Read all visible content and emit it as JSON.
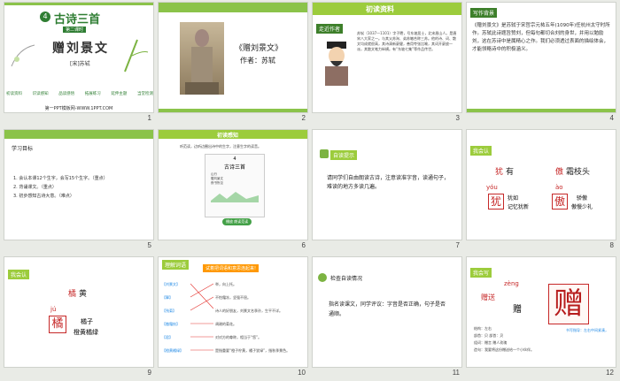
{
  "slides": [
    {
      "num": "1",
      "badge": "4",
      "title": "古诗三首",
      "subtitle": "第二课时",
      "poem_title": "赠刘景文",
      "author": "[宋]苏轼",
      "menu": [
        "初读资料",
        "识读感知",
        "品读感悟",
        "拓展练习",
        "延伸主题",
        "当堂检测"
      ],
      "footer": "第一PPT模板网-WWW.1PPT.COM"
    },
    {
      "num": "2",
      "title": "《赠刘景文》",
      "author": "作者：苏轼"
    },
    {
      "num": "3",
      "tag": "走近作者",
      "header": "初读资料",
      "bio": "苏轼（1037—1101）字子瞻，号东坡居士，北宋眉山人。是唐宋八大家之一。与其父苏洵、弟苏辙合称三苏。他的诗、词、散文均成就很高，其诗清新豪健，善用夸张比喻，其词开豪放一派，其散文笔力纵横。有“东坡七集”等作品传世。"
    },
    {
      "num": "4",
      "tag": "写作背景",
      "text": "《赠刘景文》是苏轼于宋哲宗元祐五年(1090年)任杭州太守时所作。苏轼此诗题旨赞刘，但每句都切合刘的身世，并用以勉励刘，这在苏诗中是属精心之作。我们必须透过表面的描绘体会，才能领略诗中的积极涵义。"
    },
    {
      "num": "5",
      "header": "学习目标",
      "goals": [
        "1. 会认本课12个生字，会写15个生字。（重点）",
        "2. 背诵课文。（重点）",
        "3. 初步感知古诗大意。（难点）"
      ]
    },
    {
      "num": "6",
      "header": "初读感知",
      "instruction": "听范读，边听边圈出诗中的生字，注意生字的读音。",
      "book_num": "4",
      "book_title": "古诗三首",
      "book_lines": [
        "山行",
        "赠刘景文",
        "夜书所见"
      ],
      "button": "播放 朗读范读"
    },
    {
      "num": "7",
      "tag": "自读提示",
      "text": "请同学们自由朗读古诗，注意读准字音，读通句子，难读的地方多读几遍。"
    },
    {
      "num": "8",
      "tag": "我会认",
      "chars": [
        {
          "char": "犹",
          "word": "有",
          "pinyin": "yóu",
          "words": [
            "犹如",
            "记忆犹新"
          ]
        },
        {
          "char": "傲",
          "word": "霜枝头",
          "pinyin": "ào",
          "words": [
            "骄傲",
            "傲慢少礼"
          ]
        }
      ]
    },
    {
      "num": "9",
      "tag": "我会认",
      "char": "橘",
      "word": "黄",
      "pinyin": "jú",
      "words": [
        "橘子",
        "橙黄橘绿"
      ]
    },
    {
      "num": "10",
      "header": "理解词语",
      "sub": "试着把词语和意思连起来!",
      "terms": [
        "【刘景文】",
        "【擎】",
        "【残菊】",
        "【傲霜枝】",
        "【君】",
        "【橙黄橘绿】"
      ],
      "meanings": [
        "举，向上托。",
        "不怕霜冻，坚强不屈。",
        "诗人的好朋友，刘景文名季孙，生平不详。",
        "凋谢的菊花。",
        "对对方的尊称，相当于“您”。",
        "是指重要“橙子柠黄，橘子犹绿”，指秋季景色。"
      ]
    },
    {
      "num": "11",
      "tag": "检查自读情况",
      "text": "指名读课文，同学评议：字音是否正确，句子是否通顺。"
    },
    {
      "num": "12",
      "tag": "我会写",
      "char": "赠",
      "pinyin": "zèng",
      "words": [
        "赠送",
        "赠"
      ],
      "notes": [
        "结构：左右",
        "部首：贝 部首：贝",
        "组词：赠言 赠人玫瑰",
        "造句：我要将这份赠送给一个小伙伴。"
      ],
      "tip": "书写指导：左右中间紧凑，"
    }
  ],
  "colors": {
    "green": "#8bc34a",
    "dark_green": "#3d7f2a",
    "red": "#c62828",
    "bg": "#e9ebe6"
  }
}
